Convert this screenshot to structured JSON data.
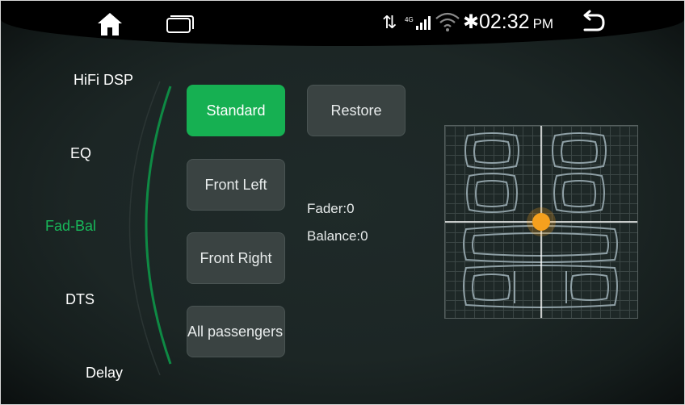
{
  "status_bar": {
    "time": "02:32",
    "ampm": "PM",
    "network": "4G",
    "icons": [
      "home-icon",
      "recents-icon",
      "data-transfer-icon",
      "signal-icon",
      "wifi-icon",
      "bluetooth-icon",
      "back-icon"
    ]
  },
  "sidebar": {
    "items": [
      {
        "label": "HiFi DSP"
      },
      {
        "label": "EQ"
      },
      {
        "label": "Fad-Bal",
        "active": true
      },
      {
        "label": "DTS"
      },
      {
        "label": "Delay"
      }
    ]
  },
  "buttons": {
    "standard": "Standard",
    "restore": "Restore",
    "front_left": "Front Left",
    "front_right": "Front Right",
    "all_passengers": "All passengers"
  },
  "readout": {
    "fader": "Fader:0",
    "balance": "Balance:0"
  },
  "balance_control": {
    "fader": 0,
    "balance": 0,
    "knob_color": "#f5a01e"
  },
  "colors": {
    "accent": "#16b052",
    "knob": "#f5a01e"
  }
}
